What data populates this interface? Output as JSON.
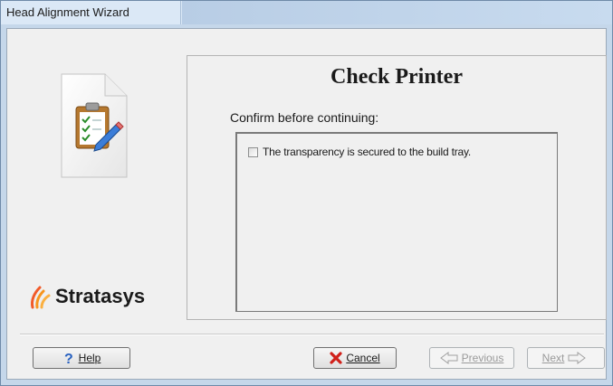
{
  "window": {
    "title": "Head Alignment Wizard"
  },
  "panel": {
    "heading": "Check Printer",
    "instruction": "Confirm before continuing:",
    "checkbox": {
      "label": "The transparency is secured to the build tray.",
      "checked": false
    }
  },
  "logo": {
    "text": "Stratasys",
    "flame_colors": [
      "#f7941d",
      "#fbb040",
      "#f15a29"
    ]
  },
  "buttons": {
    "help": {
      "label": "Help",
      "icon": "question-icon"
    },
    "cancel": {
      "label": "Cancel",
      "icon": "red-x-icon"
    },
    "previous": {
      "label": "Previous",
      "icon": "left-arrow-icon",
      "enabled": false
    },
    "next": {
      "label": "Next",
      "icon": "right-arrow-icon",
      "enabled": false
    }
  }
}
